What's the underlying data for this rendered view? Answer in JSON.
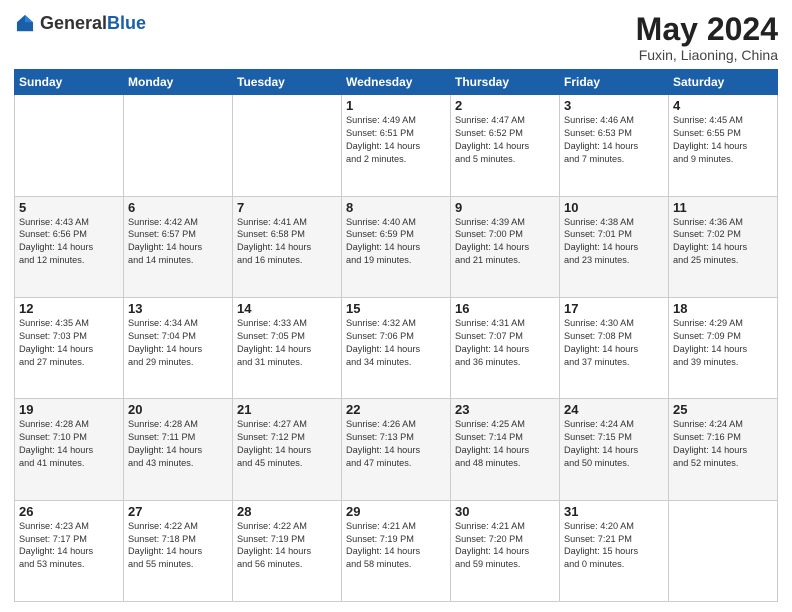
{
  "logo": {
    "general": "General",
    "blue": "Blue"
  },
  "header": {
    "month_year": "May 2024",
    "location": "Fuxin, Liaoning, China"
  },
  "days_of_week": [
    "Sunday",
    "Monday",
    "Tuesday",
    "Wednesday",
    "Thursday",
    "Friday",
    "Saturday"
  ],
  "weeks": [
    [
      {
        "day": "",
        "info": ""
      },
      {
        "day": "",
        "info": ""
      },
      {
        "day": "",
        "info": ""
      },
      {
        "day": "1",
        "info": "Sunrise: 4:49 AM\nSunset: 6:51 PM\nDaylight: 14 hours\nand 2 minutes."
      },
      {
        "day": "2",
        "info": "Sunrise: 4:47 AM\nSunset: 6:52 PM\nDaylight: 14 hours\nand 5 minutes."
      },
      {
        "day": "3",
        "info": "Sunrise: 4:46 AM\nSunset: 6:53 PM\nDaylight: 14 hours\nand 7 minutes."
      },
      {
        "day": "4",
        "info": "Sunrise: 4:45 AM\nSunset: 6:55 PM\nDaylight: 14 hours\nand 9 minutes."
      }
    ],
    [
      {
        "day": "5",
        "info": "Sunrise: 4:43 AM\nSunset: 6:56 PM\nDaylight: 14 hours\nand 12 minutes."
      },
      {
        "day": "6",
        "info": "Sunrise: 4:42 AM\nSunset: 6:57 PM\nDaylight: 14 hours\nand 14 minutes."
      },
      {
        "day": "7",
        "info": "Sunrise: 4:41 AM\nSunset: 6:58 PM\nDaylight: 14 hours\nand 16 minutes."
      },
      {
        "day": "8",
        "info": "Sunrise: 4:40 AM\nSunset: 6:59 PM\nDaylight: 14 hours\nand 19 minutes."
      },
      {
        "day": "9",
        "info": "Sunrise: 4:39 AM\nSunset: 7:00 PM\nDaylight: 14 hours\nand 21 minutes."
      },
      {
        "day": "10",
        "info": "Sunrise: 4:38 AM\nSunset: 7:01 PM\nDaylight: 14 hours\nand 23 minutes."
      },
      {
        "day": "11",
        "info": "Sunrise: 4:36 AM\nSunset: 7:02 PM\nDaylight: 14 hours\nand 25 minutes."
      }
    ],
    [
      {
        "day": "12",
        "info": "Sunrise: 4:35 AM\nSunset: 7:03 PM\nDaylight: 14 hours\nand 27 minutes."
      },
      {
        "day": "13",
        "info": "Sunrise: 4:34 AM\nSunset: 7:04 PM\nDaylight: 14 hours\nand 29 minutes."
      },
      {
        "day": "14",
        "info": "Sunrise: 4:33 AM\nSunset: 7:05 PM\nDaylight: 14 hours\nand 31 minutes."
      },
      {
        "day": "15",
        "info": "Sunrise: 4:32 AM\nSunset: 7:06 PM\nDaylight: 14 hours\nand 34 minutes."
      },
      {
        "day": "16",
        "info": "Sunrise: 4:31 AM\nSunset: 7:07 PM\nDaylight: 14 hours\nand 36 minutes."
      },
      {
        "day": "17",
        "info": "Sunrise: 4:30 AM\nSunset: 7:08 PM\nDaylight: 14 hours\nand 37 minutes."
      },
      {
        "day": "18",
        "info": "Sunrise: 4:29 AM\nSunset: 7:09 PM\nDaylight: 14 hours\nand 39 minutes."
      }
    ],
    [
      {
        "day": "19",
        "info": "Sunrise: 4:28 AM\nSunset: 7:10 PM\nDaylight: 14 hours\nand 41 minutes."
      },
      {
        "day": "20",
        "info": "Sunrise: 4:28 AM\nSunset: 7:11 PM\nDaylight: 14 hours\nand 43 minutes."
      },
      {
        "day": "21",
        "info": "Sunrise: 4:27 AM\nSunset: 7:12 PM\nDaylight: 14 hours\nand 45 minutes."
      },
      {
        "day": "22",
        "info": "Sunrise: 4:26 AM\nSunset: 7:13 PM\nDaylight: 14 hours\nand 47 minutes."
      },
      {
        "day": "23",
        "info": "Sunrise: 4:25 AM\nSunset: 7:14 PM\nDaylight: 14 hours\nand 48 minutes."
      },
      {
        "day": "24",
        "info": "Sunrise: 4:24 AM\nSunset: 7:15 PM\nDaylight: 14 hours\nand 50 minutes."
      },
      {
        "day": "25",
        "info": "Sunrise: 4:24 AM\nSunset: 7:16 PM\nDaylight: 14 hours\nand 52 minutes."
      }
    ],
    [
      {
        "day": "26",
        "info": "Sunrise: 4:23 AM\nSunset: 7:17 PM\nDaylight: 14 hours\nand 53 minutes."
      },
      {
        "day": "27",
        "info": "Sunrise: 4:22 AM\nSunset: 7:18 PM\nDaylight: 14 hours\nand 55 minutes."
      },
      {
        "day": "28",
        "info": "Sunrise: 4:22 AM\nSunset: 7:19 PM\nDaylight: 14 hours\nand 56 minutes."
      },
      {
        "day": "29",
        "info": "Sunrise: 4:21 AM\nSunset: 7:19 PM\nDaylight: 14 hours\nand 58 minutes."
      },
      {
        "day": "30",
        "info": "Sunrise: 4:21 AM\nSunset: 7:20 PM\nDaylight: 14 hours\nand 59 minutes."
      },
      {
        "day": "31",
        "info": "Sunrise: 4:20 AM\nSunset: 7:21 PM\nDaylight: 15 hours\nand 0 minutes."
      },
      {
        "day": "",
        "info": ""
      }
    ]
  ]
}
